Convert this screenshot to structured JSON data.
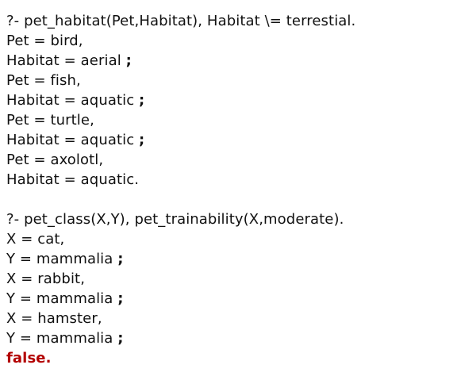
{
  "colors": {
    "text": "#111111",
    "false_result": "#b30000",
    "background": "#ffffff"
  },
  "queries": [
    {
      "prompt": "?- pet_habitat(Pet,Habitat), Habitat \\= terrestial.",
      "answers": [
        {
          "first": "Pet = bird,",
          "second": "Habitat = aerial",
          "sep": ";"
        },
        {
          "first": "Pet = fish,",
          "second": "Habitat = aquatic",
          "sep": ";"
        },
        {
          "first": "Pet = turtle,",
          "second": "Habitat = aquatic",
          "sep": ";"
        },
        {
          "first": "Pet = axolotl,",
          "second": "Habitat = aquatic.",
          "sep": ""
        }
      ]
    },
    {
      "prompt": "?- pet_class(X,Y), pet_trainability(X,moderate).",
      "answers": [
        {
          "first": "X = cat,",
          "second": "Y = mammalia",
          "sep": ";"
        },
        {
          "first": "X = rabbit,",
          "second": "Y = mammalia",
          "sep": ";"
        },
        {
          "first": "X = hamster,",
          "second": "Y = mammalia",
          "sep": ";"
        }
      ],
      "result": "false."
    }
  ]
}
